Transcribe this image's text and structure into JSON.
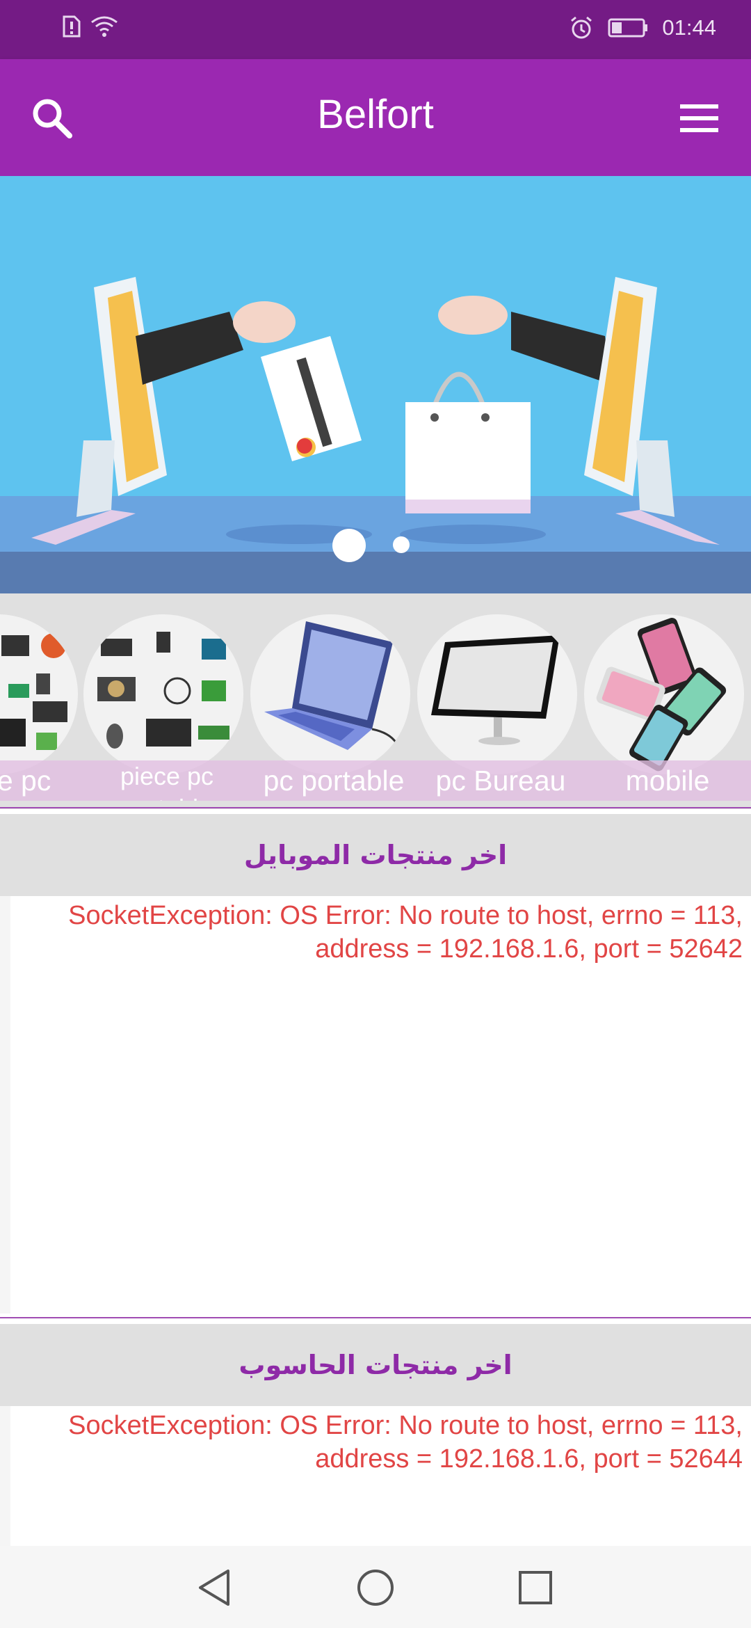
{
  "status_bar": {
    "time": "01:44",
    "icons": [
      "sim-alert-icon",
      "wifi-icon",
      "alarm-icon",
      "battery-icon"
    ]
  },
  "app_bar": {
    "title": "Belfort",
    "left_icon": "search-icon",
    "right_icon": "menu-icon"
  },
  "banner": {
    "slides_total": 2,
    "active_slide": 1
  },
  "categories": [
    {
      "label": "piece pc"
    },
    {
      "label": "piece pc portable"
    },
    {
      "label": "pc portable"
    },
    {
      "label": "pc Bureau"
    },
    {
      "label": "mobile"
    }
  ],
  "sections": [
    {
      "title": "اخر منتجات الموبايل",
      "error": "SocketException: OS Error: No route to host, errno = 113, address = 192.168.1.6, port = 52642"
    },
    {
      "title": "اخر منتجات الحاسوب",
      "error": "SocketException: OS Error: No route to host, errno = 113, address = 192.168.1.6, port = 52644"
    }
  ],
  "nav_bar": {
    "buttons": [
      "back-icon",
      "home-icon",
      "recents-icon"
    ]
  },
  "colors": {
    "status_bar": "#741b85",
    "app_bar": "#9b28b1",
    "section_title": "#8e2aa7",
    "error_text": "#e14545",
    "banner_bg": "#5ec3ef"
  }
}
